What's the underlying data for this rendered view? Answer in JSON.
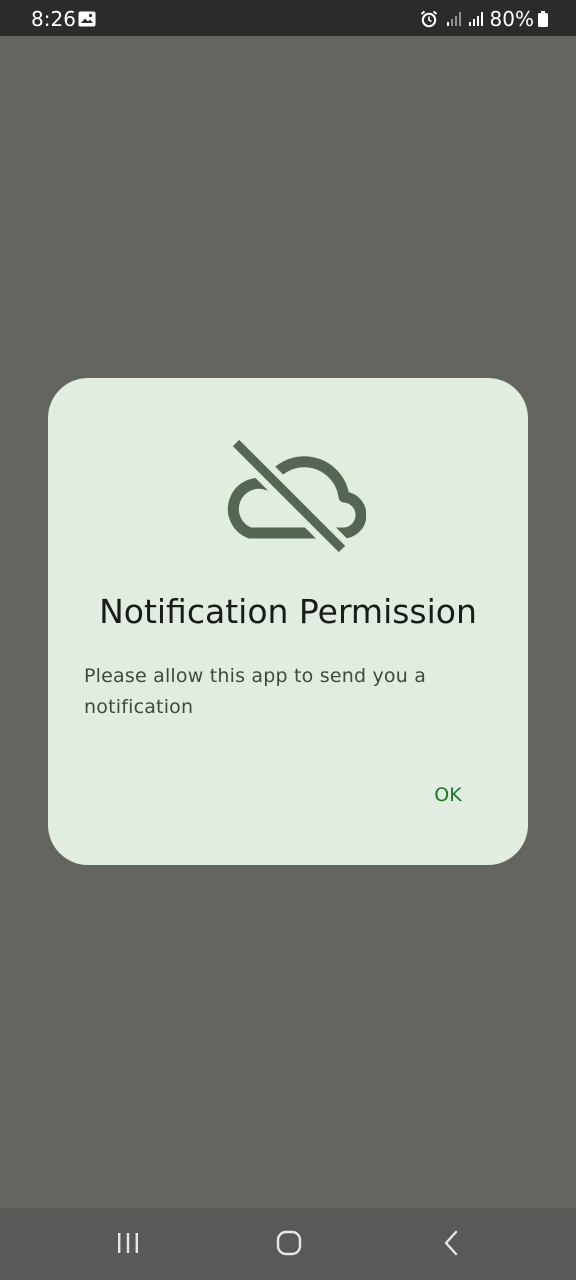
{
  "status_bar": {
    "time": "8:26",
    "battery": "80%",
    "icons": [
      "image-icon",
      "alarm-icon",
      "signal-icon",
      "signal-icon",
      "battery-icon"
    ]
  },
  "dialog": {
    "icon": "cloud-off-icon",
    "title": "Notification Permission",
    "message": "Please allow this app to send you a notification",
    "ok_label": "OK"
  },
  "nav_bar": {
    "icons": [
      "recents-icon",
      "home-icon",
      "back-icon"
    ]
  },
  "colors": {
    "scrim": "#646561",
    "dialog_bg": "#e1ede0",
    "accent": "#1a7a26",
    "icon": "#566653"
  }
}
